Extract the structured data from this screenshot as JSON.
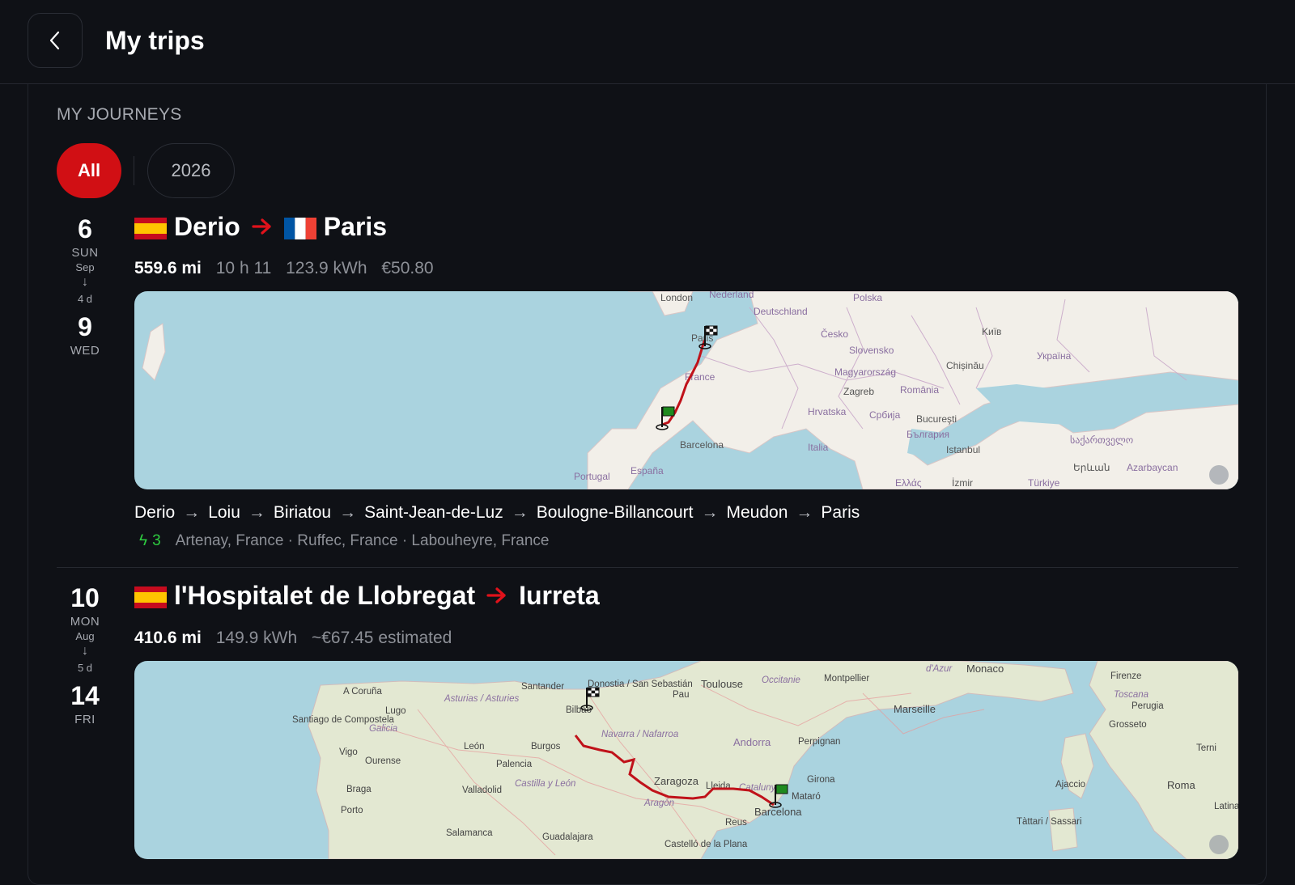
{
  "header": {
    "title": "My trips"
  },
  "section_label": "MY JOURNEYS",
  "filters": {
    "all": "All",
    "year": "2026"
  },
  "trips": [
    {
      "start_day": "6",
      "start_weekday": "SUN",
      "month": "Sep",
      "duration": "4 d",
      "end_day": "9",
      "end_weekday": "WED",
      "from": "Derio",
      "to": "Paris",
      "from_flag": "spain-flag",
      "to_flag": "france-flag",
      "distance": "559.6 mi",
      "time": "10 h 11",
      "energy": "123.9 kWh",
      "cost": "€50.80",
      "map_labels": {
        "l1": "London",
        "l2": "Nederland",
        "l3": "Polska",
        "l4": "Deutschland",
        "l5": "Kиїв",
        "l6": "Česko",
        "l7": "Slovensko",
        "l8": "Україна",
        "l9": "Chișinău",
        "l10": "Magyarország",
        "l11": "Zagreb",
        "l12": "România",
        "l13": "Hrvatska",
        "l14": "Србија",
        "l15": "Bucureşti",
        "l16": "България",
        "l17": "Italia",
        "l18": "Istanbul",
        "l19": "საქართველო",
        "l20": "Barcelona",
        "l21": "España",
        "l22": "Portugal",
        "l23": "France",
        "l24": "Paris",
        "l25": "Երևան",
        "l26": "Azarbaycan",
        "l27": "Türkiye",
        "l28": "İzmir",
        "l29": "Ελλάς"
      },
      "stops": [
        "Derio",
        "Loiu",
        "Biriatou",
        "Saint-Jean-de-Luz",
        "Boulogne-Billancourt",
        "Meudon",
        "Paris"
      ],
      "charger_count": "3",
      "chargers": "Artenay, France · Ruffec, France · Labouheyre, France"
    },
    {
      "start_day": "10",
      "start_weekday": "MON",
      "month": "Aug",
      "duration": "5 d",
      "end_day": "14",
      "end_weekday": "FRI",
      "from": "l'Hospitalet de Llobregat",
      "to": "Iurreta",
      "from_flag": "spain-flag",
      "to_flag": "",
      "distance": "410.6 mi",
      "energy": "149.9 kWh",
      "cost_estimate": "~€67.45 estimated",
      "map_labels": {
        "l1": "A Coruña",
        "l2": "Santander",
        "l3": "Donostia / San Sebastián",
        "l4": "Toulouse",
        "l5": "Occitanie",
        "l6": "Montpellier",
        "l7": "Monaco",
        "l8": "Firenze",
        "l9": "Lugo",
        "l10": "Santiago de Compostela",
        "l11": "Asturias / Asturies",
        "l12": "Bilbao",
        "l13": "Pau",
        "l14": "Marseille",
        "l15": "Toscana",
        "l16": "Perugia",
        "l17": "Galicia",
        "l18": "Navarra / Nafarroa",
        "l19": "Grosseto",
        "l20": "Andorra",
        "l21": "Perpignan",
        "l22": "Vigo",
        "l23": "Ourense",
        "l24": "León",
        "l25": "Burgos",
        "l26": "Palencia",
        "l27": "Zaragoza",
        "l28": "Lleida",
        "l29": "Girona",
        "l30": "Terni",
        "l31": "Braga",
        "l32": "Valladolid",
        "l33": "Castilla y León",
        "l34": "Aragón",
        "l35": "Mataró",
        "l36": "Ajaccio",
        "l37": "Roma",
        "l38": "Porto",
        "l39": "Barcelona",
        "l40": "Reus",
        "l41": "Latina",
        "l42": "Salamanca",
        "l43": "Guadalajara",
        "l44": "Castelló de la Plana",
        "l45": "Tàttari / Sassari",
        "l46": "Catalunya",
        "l47": "d'Azur"
      }
    }
  ]
}
